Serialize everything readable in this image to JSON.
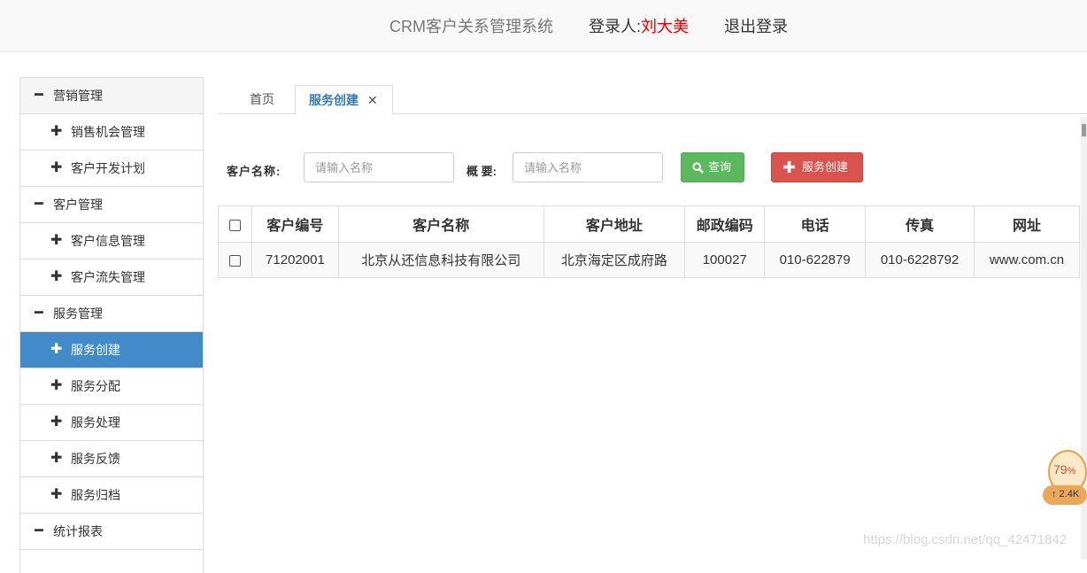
{
  "header": {
    "title": "CRM客户关系管理系统",
    "login_label": "登录人:",
    "login_user": "刘大美",
    "logout": "退出登录"
  },
  "sidebar": {
    "items": [
      {
        "label": "营销管理",
        "icon": "minus-icon",
        "kind": "group"
      },
      {
        "label": "销售机会管理",
        "icon": "plus-icon",
        "kind": "sub"
      },
      {
        "label": "客户开发计划",
        "icon": "plus-icon",
        "kind": "sub"
      },
      {
        "label": "客户管理",
        "icon": "minus-icon",
        "kind": "group"
      },
      {
        "label": "客户信息管理",
        "icon": "plus-icon",
        "kind": "sub"
      },
      {
        "label": "客户流失管理",
        "icon": "plus-icon",
        "kind": "sub"
      },
      {
        "label": "服务管理",
        "icon": "minus-icon",
        "kind": "group"
      },
      {
        "label": "服务创建",
        "icon": "plus-icon",
        "kind": "sub",
        "active": true
      },
      {
        "label": "服务分配",
        "icon": "plus-icon",
        "kind": "sub"
      },
      {
        "label": "服务处理",
        "icon": "plus-icon",
        "kind": "sub"
      },
      {
        "label": "服务反馈",
        "icon": "plus-icon",
        "kind": "sub"
      },
      {
        "label": "服务归档",
        "icon": "plus-icon",
        "kind": "sub"
      },
      {
        "label": "统计报表",
        "icon": "minus-icon",
        "kind": "group"
      }
    ]
  },
  "tabs": {
    "home": "首页",
    "current": "服务创建",
    "close_icon": "close-icon"
  },
  "search": {
    "customer_label": "客户名称:",
    "customer_placeholder": "请输入名称",
    "summary_label": "概 要:",
    "summary_placeholder": "请输入名称",
    "query_button": "查询",
    "query_icon": "search-icon",
    "create_button": "服务创建",
    "create_icon": "plus-icon"
  },
  "table": {
    "columns": [
      "客户编号",
      "客户名称",
      "客户地址",
      "邮政编码",
      "电话",
      "传真",
      "网址"
    ],
    "rows": [
      [
        "71202001",
        "北京从还信息科技有限公司",
        "北京海定区成府路",
        "100027",
        "010-622879",
        "010-6228792",
        "www.com.cn"
      ]
    ]
  },
  "widget": {
    "percent": "79",
    "percent_unit": "%",
    "speed": "↑ 2.4K"
  },
  "watermark": "https://blog.csdn.net/qq_42471842",
  "colors": {
    "active_bg": "#428bca",
    "query_btn": "#5cb85c",
    "create_btn": "#d9534f",
    "user_name": "#e00000"
  }
}
